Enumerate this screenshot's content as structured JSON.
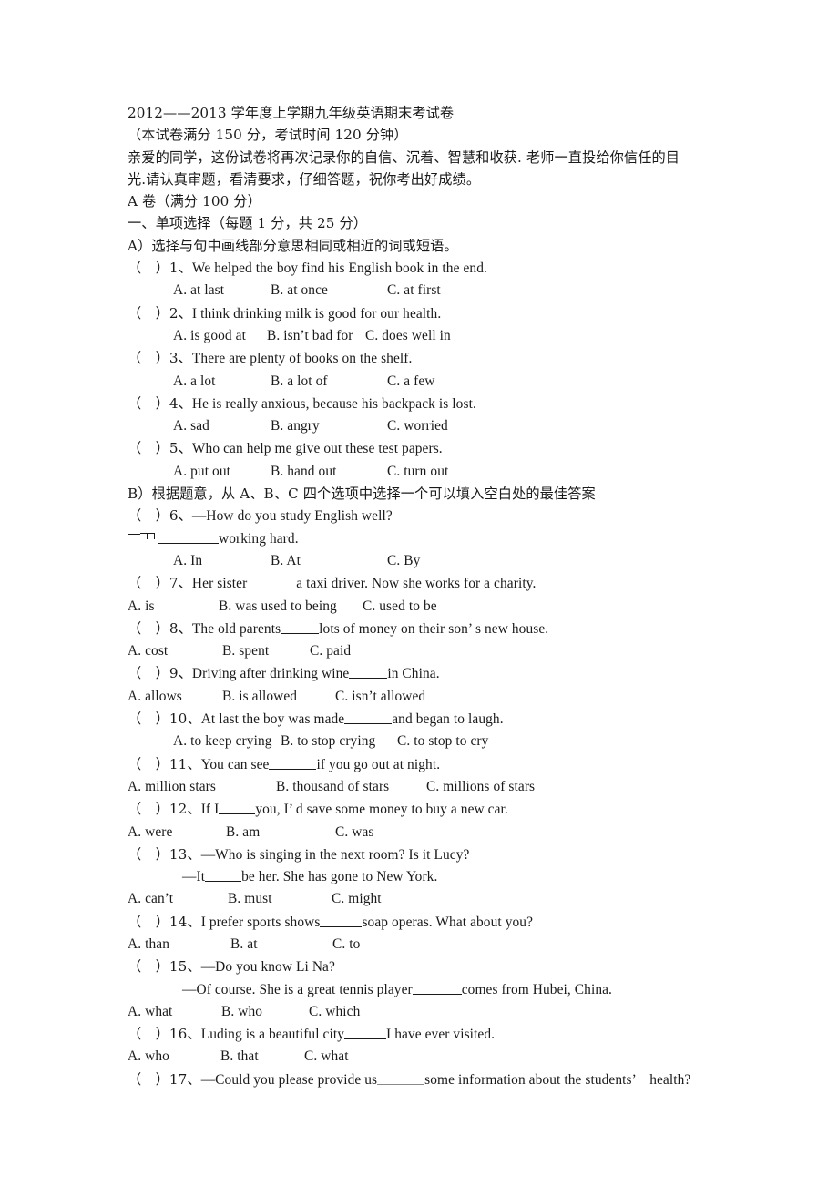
{
  "document": {
    "title_line": "2012——2013 学年度上学期九年级英语期末考试卷",
    "subtitle_line": "（本试卷满分 150 分，考试时间 120 分钟）",
    "greeting_line_1": "亲爱的同学，这份试卷将再次记录你的自信、沉着、智慧和收获. 老师一直投给你信任的目",
    "greeting_line_2": "光.请认真审题，看清要求，仔细答题，祝你考出好成绩。",
    "paper_a_line": "A 卷（满分 100 分）",
    "section_one_heading": "一、单项选择（每题 1 分，共 25 分）",
    "part_a_heading": "A）选择与句中画线部分意思相同或相近的词或短语。",
    "part_b_heading": "B）根据题意，从 A、B、C 四个选项中选择一个可以填入空白处的最佳答案"
  },
  "questions": {
    "q1": {
      "stem_prefix": "（　）1、",
      "stem": "We helped the boy find his English book in the end.",
      "a": "A. at last",
      "b": "B. at once",
      "c": "C. at first"
    },
    "q2": {
      "stem_prefix": "（　）2、",
      "stem": "I think drinking milk is good for our health.",
      "a": "A. is good at",
      "b": "B. isn’t bad for",
      "c": "C. does well in"
    },
    "q3": {
      "stem_prefix": "（　）3、",
      "stem": "There are plenty of books on the shelf.",
      "a": "A. a lot",
      "b": "B. a lot of",
      "c": "C. a few"
    },
    "q4": {
      "stem_prefix": "（　）4、",
      "stem": "He is really anxious, because his backpack is lost.",
      "a": "A. sad",
      "b": "B. angry",
      "c": "C. worried"
    },
    "q5": {
      "stem_prefix": "（　）5、",
      "stem": "Who can help me give out these test papers.",
      "a": "A. put out",
      "b": "B. hand out",
      "c": "C. turn out"
    },
    "q6": {
      "stem_prefix": "（　）6、",
      "stem": "—How do you study English well?",
      "answer_tail": "working hard.",
      "a": "A. In",
      "b": "B. At",
      "c": "C. By"
    },
    "q7": {
      "stem_prefix": "（　）7、",
      "stem_before": "Her sister ",
      "stem_after": "a taxi driver. Now she works for a charity.",
      "a": "A. is",
      "b": "B. was used to being",
      "c": "C. used to be"
    },
    "q8": {
      "stem_prefix": "（　）8、",
      "stem_before": "The old parents",
      "stem_after": "lots of money on their son’ s new house.",
      "a": "A. cost",
      "b": "B. spent",
      "c": "C. paid"
    },
    "q9": {
      "stem_prefix": "（　）9、",
      "stem_before": "Driving after drinking wine",
      "stem_after": "in China.",
      "a": "A. allows",
      "b": "B. is allowed",
      "c": "C. isn’t allowed"
    },
    "q10": {
      "stem_prefix": "（　）10、",
      "stem_before": "At last the boy was made",
      "stem_after": "and began to laugh.",
      "a": "A. to keep crying",
      "b": "B. to stop crying",
      "c": "C. to stop to cry"
    },
    "q11": {
      "stem_prefix": "（　）11、",
      "stem_before": "You can see",
      "stem_after": "if you go out at night.",
      "a": "A. million stars",
      "b": "B. thousand of stars",
      "c": "C. millions of stars"
    },
    "q12": {
      "stem_prefix": "（　）12、",
      "stem_before": "If I",
      "stem_after": "you, I’ d save some money to buy a new car.",
      "a": "A. were",
      "b": "B. am",
      "c": "C. was"
    },
    "q13": {
      "stem_prefix": "（　）13、",
      "stem": "—Who is singing in the next room? Is it Lucy?",
      "sub_before": "—It",
      "sub_after": "be her. She has gone to New York.",
      "a": "A. can’t",
      "b": "B. must",
      "c": "C. might"
    },
    "q14": {
      "stem_prefix": "（　）14、",
      "stem_before": "I prefer sports shows",
      "stem_after": "soap operas. What about you?",
      "a": "A. than",
      "b": "B. at",
      "c": "C. to"
    },
    "q15": {
      "stem_prefix": "（　）15、",
      "stem": "—Do you know Li Na?",
      "sub_before": "—Of course. She is a great tennis player",
      "sub_after": "comes from Hubei, China.",
      "a": "A. what",
      "b": "B. who",
      "c": "C. which"
    },
    "q16": {
      "stem_prefix": "（　）16、",
      "stem_before": "Luding is a beautiful city",
      "stem_after": "I have ever visited.",
      "a": "A. who",
      "b": "B. that",
      "c": "C. what"
    },
    "q17": {
      "stem_prefix": "（　）17、",
      "stem_before": "—Could you please provide us",
      "stem_after": "some information about the students’　health?"
    }
  }
}
